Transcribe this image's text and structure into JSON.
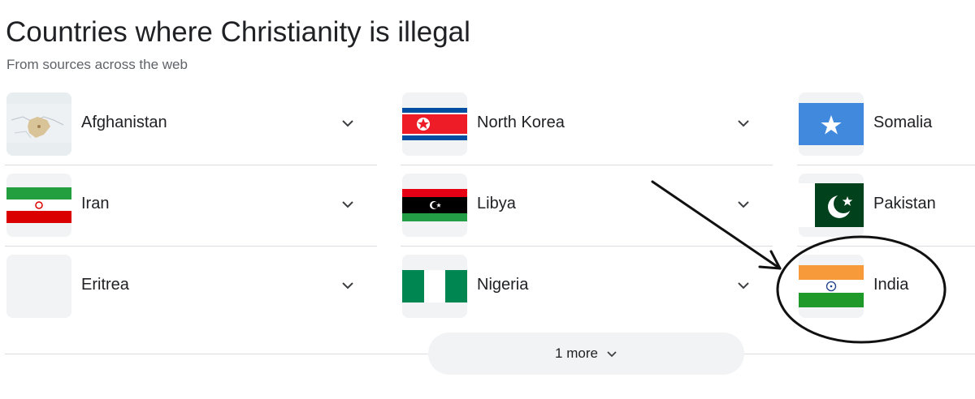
{
  "header": {
    "title": "Countries where Christianity is illegal",
    "subtitle": "From sources across the web"
  },
  "columns": [
    {
      "items": [
        {
          "label": "Afghanistan",
          "icon": "afghanistan-map-thumbnail"
        },
        {
          "label": "Iran",
          "icon": "iran-flag"
        },
        {
          "label": "Eritrea",
          "icon": "blank-thumbnail"
        }
      ]
    },
    {
      "items": [
        {
          "label": "North Korea",
          "icon": "north-korea-flag"
        },
        {
          "label": "Libya",
          "icon": "libya-flag"
        },
        {
          "label": "Nigeria",
          "icon": "nigeria-flag"
        }
      ]
    },
    {
      "items": [
        {
          "label": "Somalia",
          "icon": "somalia-flag"
        },
        {
          "label": "Pakistan",
          "icon": "pakistan-flag"
        },
        {
          "label": "India",
          "icon": "india-flag"
        }
      ]
    }
  ],
  "more_button": {
    "label": "1 more",
    "icon": "chevron-down-icon"
  },
  "colors": {
    "divider": "#dadce0",
    "thumb_bg": "#f1f3f4",
    "text": "#202124",
    "subtext": "#5f6368"
  }
}
